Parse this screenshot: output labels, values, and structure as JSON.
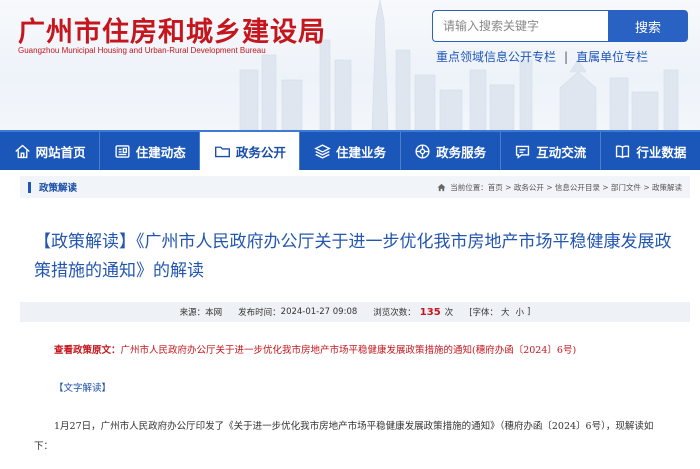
{
  "header": {
    "logo_cn": "广州市住房和城乡建设局",
    "logo_en": "Guangzhou Municipal Housing and Urban-Rural Development Bureau",
    "search_placeholder": "请输入搜索关键字",
    "search_button": "搜索",
    "quick_link_1": "重点领域信息公开专栏",
    "quick_link_2": "直属单位专栏",
    "quick_sep": "|"
  },
  "nav": {
    "items": [
      {
        "label": "网站首页",
        "icon": "home-icon"
      },
      {
        "label": "住建动态",
        "icon": "news-icon"
      },
      {
        "label": "政务公开",
        "icon": "folder-icon"
      },
      {
        "label": "住建业务",
        "icon": "layers-icon"
      },
      {
        "label": "政务服务",
        "icon": "service-icon"
      },
      {
        "label": "互动交流",
        "icon": "chat-icon"
      },
      {
        "label": "行业数据",
        "icon": "book-icon"
      }
    ],
    "active_index": 2
  },
  "crumb": {
    "section": "政策解读",
    "path": "当前位置：首页 > 政务公开 > 信息公开目录 > 部门文件 > 政策解读"
  },
  "article": {
    "title": "【政策解读】《广州市人民政府办公厅关于进一步优化我市房地产市场平稳健康发展政策措施的通知》的解读",
    "source_label": "来源：",
    "source": "本网",
    "time_label": "发布时间：",
    "time": "2024-01-27 09:08",
    "hits_label": "浏览次数：",
    "hits": "135",
    "hits_unit": "次",
    "font_label": "[字体：",
    "font_large": "大",
    "font_small": "小",
    "font_close": "]",
    "orig_label": "查看政策原文：",
    "orig_text": "广州市人民政府办公厅关于进一步优化我市房地产市场平稳健康发展政策措施的通知(穗府办函〔2024〕6号)",
    "section_heading": "【文字解读】",
    "paragraph": "1月27日，广州市人民政府办公厅印发了《关于进一步优化我市房地产市场平稳健康发展政策措施的通知》（穗府办函〔2024〕6号），现解读如下："
  },
  "colors": {
    "brand_red": "#c4161c",
    "nav_blue": "#1a57b9",
    "title_blue": "#2356b0"
  }
}
